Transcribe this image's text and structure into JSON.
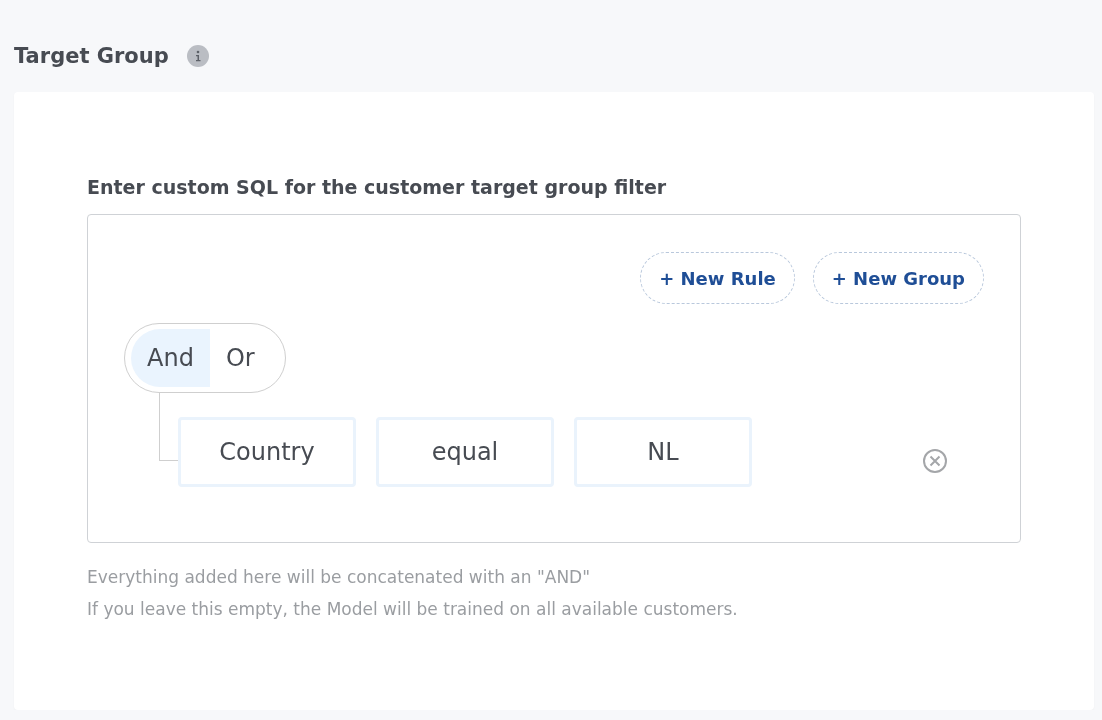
{
  "section_title": "Target Group",
  "builder": {
    "label": "Enter custom SQL for the customer target group filter",
    "actions": [
      "+ New Rule",
      "+ New Group"
    ],
    "combinators": [
      {
        "label": "And",
        "selected": true
      },
      {
        "label": "Or",
        "selected": false
      }
    ],
    "rules": [
      {
        "field": "Country",
        "operator": "equal",
        "value": "NL"
      }
    ]
  },
  "help_lines": [
    "Everything added here will be concatenated with an \"AND\"",
    "If you leave this empty, the Model will be trained on all available customers."
  ]
}
